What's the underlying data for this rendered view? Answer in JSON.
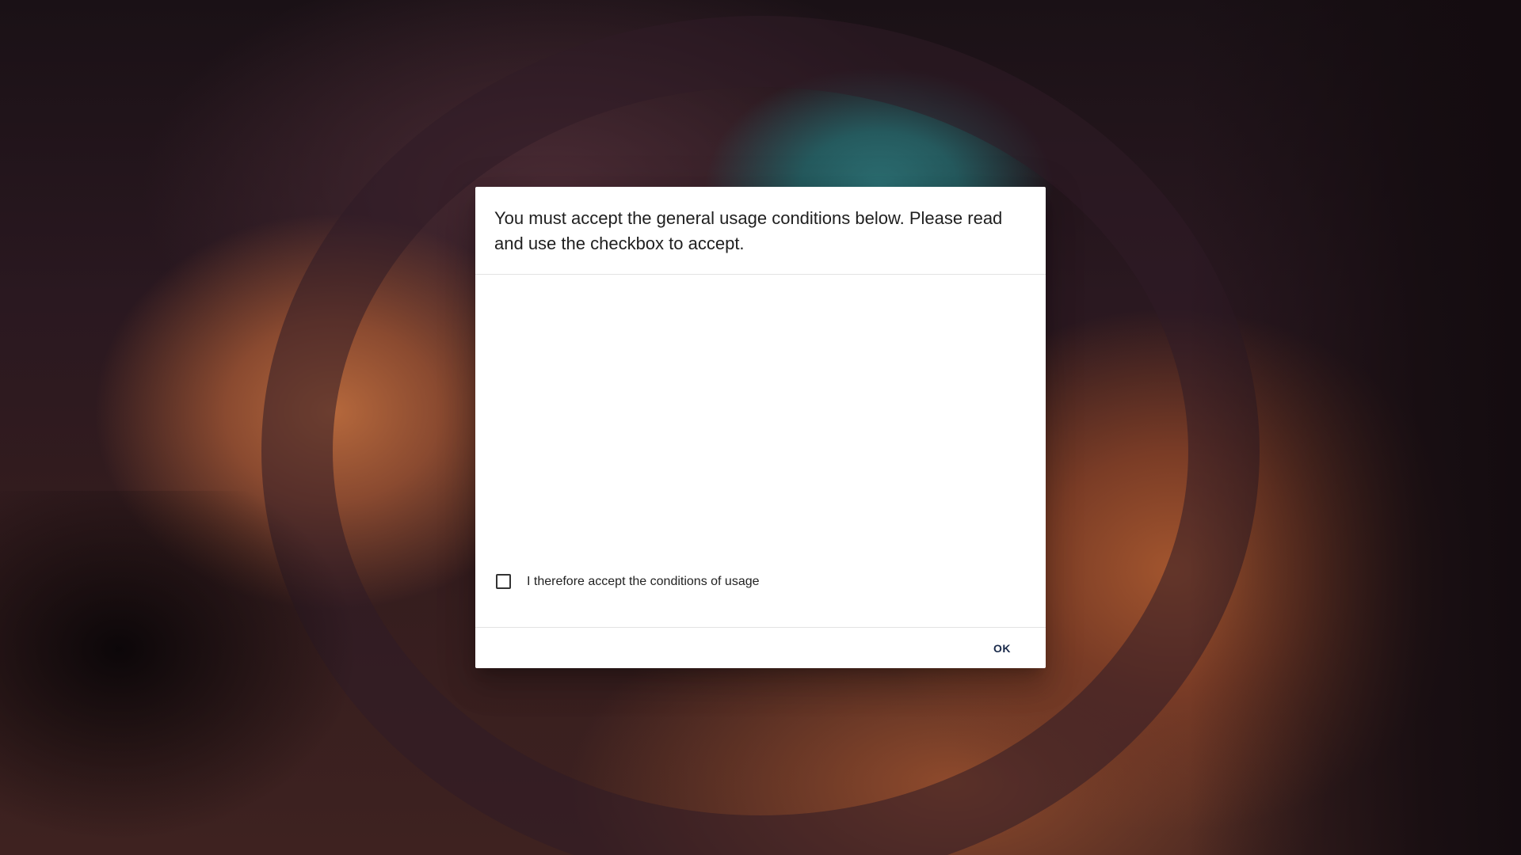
{
  "dialog": {
    "title": "You must accept the general usage conditions below. Please read and use the checkbox to accept.",
    "conditions_text": "",
    "checkbox": {
      "label": "I therefore accept the conditions of usage",
      "checked": false
    },
    "ok_label": "OK"
  },
  "colors": {
    "dialog_background": "#ffffff",
    "button_text": "#1a2a4a"
  }
}
